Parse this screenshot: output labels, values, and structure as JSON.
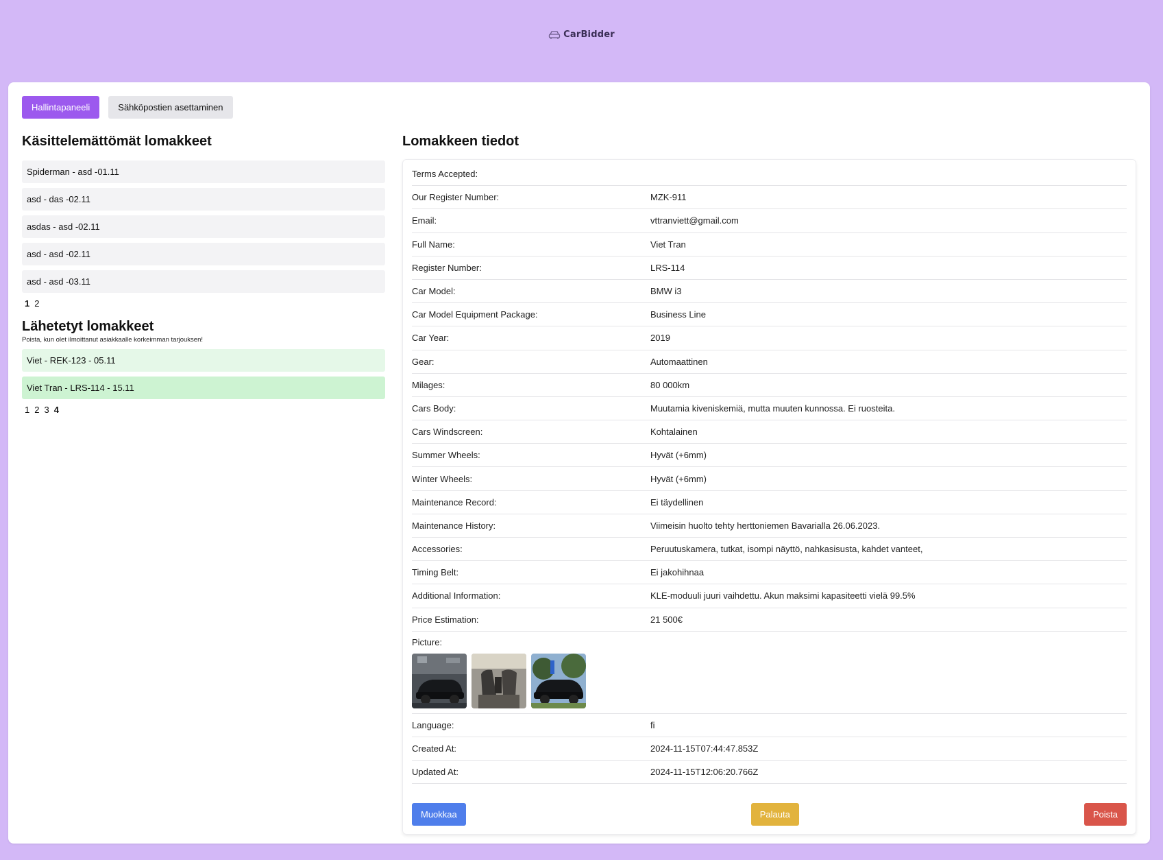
{
  "brand": {
    "name": "CarBidder"
  },
  "tabs": [
    {
      "label": "Hallintapaneeli",
      "active": true
    },
    {
      "label": "Sähköpostien asettaminen",
      "active": false
    }
  ],
  "unprocessed": {
    "title": "Käsittelemättömät lomakkeet",
    "items": [
      "Spiderman - asd -01.11",
      "asd - das -02.11",
      "asdas - asd -02.11",
      "asd - asd -02.11",
      "asd - asd -03.11"
    ],
    "pages": [
      "1",
      "2"
    ],
    "current_page": "1"
  },
  "sent": {
    "title": "Lähetetyt lomakkeet",
    "note": "Poista, kun olet ilmoittanut asiakkaalle korkeimman tarjouksen!",
    "items": [
      "Viet - REK-123 - 05.11",
      "Viet Tran - LRS-114 - 15.11"
    ],
    "pages": [
      "1",
      "2",
      "3",
      "4"
    ],
    "current_page": "4"
  },
  "details": {
    "title": "Lomakkeen tiedot",
    "fields": [
      {
        "label": "Terms Accepted:",
        "value": ""
      },
      {
        "label": "Our Register Number:",
        "value": "MZK-911"
      },
      {
        "label": "Email:",
        "value": "vttranviett@gmail.com"
      },
      {
        "label": "Full Name:",
        "value": "Viet Tran"
      },
      {
        "label": "Register Number:",
        "value": "LRS-114"
      },
      {
        "label": "Car Model:",
        "value": "BMW i3"
      },
      {
        "label": "Car Model Equipment Package:",
        "value": "Business Line"
      },
      {
        "label": "Car Year:",
        "value": "2019"
      },
      {
        "label": "Gear:",
        "value": "Automaattinen"
      },
      {
        "label": "Milages:",
        "value": "80 000km"
      },
      {
        "label": "Cars Body:",
        "value": "Muutamia kiveniskemiä, mutta muuten kunnossa. Ei ruosteita."
      },
      {
        "label": "Cars Windscreen:",
        "value": "Kohtalainen"
      },
      {
        "label": "Summer Wheels:",
        "value": "Hyvät (+6mm)"
      },
      {
        "label": "Winter Wheels:",
        "value": "Hyvät (+6mm)"
      },
      {
        "label": "Maintenance Record:",
        "value": "Ei täydellinen"
      },
      {
        "label": "Maintenance History:",
        "value": "Viimeisin huolto tehty herttoniemen Bavarialla 26.06.2023."
      },
      {
        "label": "Accessories:",
        "value": "Peruutuskamera, tutkat, isompi näyttö, nahkasisusta, kahdet vanteet,"
      },
      {
        "label": "Timing Belt:",
        "value": "Ei jakohihnaa"
      },
      {
        "label": "Additional Information:",
        "value": "KLE-moduuli juuri vaihdettu. Akun maksimi kapasiteetti vielä 99.5%"
      },
      {
        "label": "Price Estimation:",
        "value": "21 500€"
      }
    ],
    "picture_label": "Picture:",
    "pictures": [
      "car-garage-photo",
      "car-interior-photo",
      "car-outdoor-photo"
    ],
    "meta_fields": [
      {
        "label": "Language:",
        "value": "fi"
      },
      {
        "label": "Created At:",
        "value": "2024-11-15T07:44:47.853Z"
      },
      {
        "label": "Updated At:",
        "value": "2024-11-15T12:06:20.766Z"
      }
    ],
    "buttons": {
      "edit": "Muokkaa",
      "restore": "Palauta",
      "delete": "Poista"
    }
  },
  "colors": {
    "background": "#d3b8f7",
    "primary": "#9c59ee",
    "edit": "#4f7eeb",
    "restore": "#e2b33d",
    "delete": "#d9554a"
  }
}
